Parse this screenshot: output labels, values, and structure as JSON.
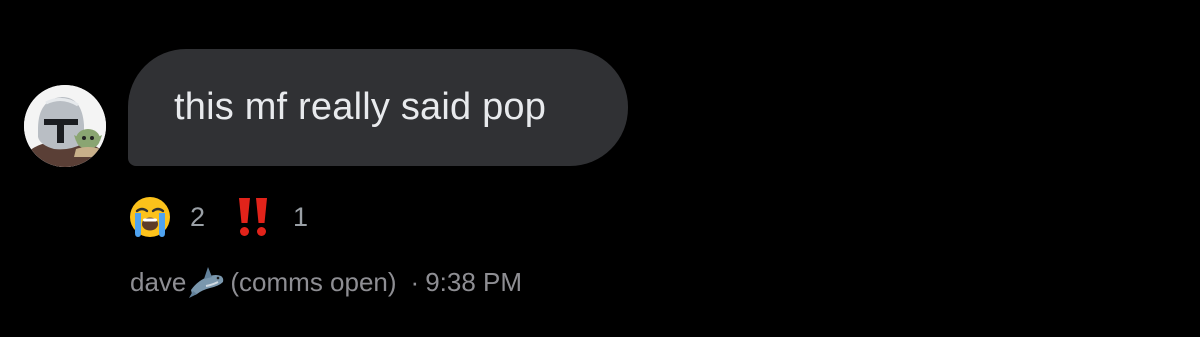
{
  "message": {
    "text": "this mf really said pop",
    "bubble_color": "#303134",
    "text_color": "#e8eaed"
  },
  "avatar": {
    "icon": "mandalorian-helmet-avatar"
  },
  "reactions": [
    {
      "icon": "loudly-crying-face-icon",
      "count": "2"
    },
    {
      "icon": "double-exclamation-icon",
      "count": "1"
    }
  ],
  "meta": {
    "sender": "dave",
    "sender_icon": "shark-icon",
    "sender_suffix": "(comms open)",
    "separator": "·",
    "time": "9:38 PM"
  }
}
